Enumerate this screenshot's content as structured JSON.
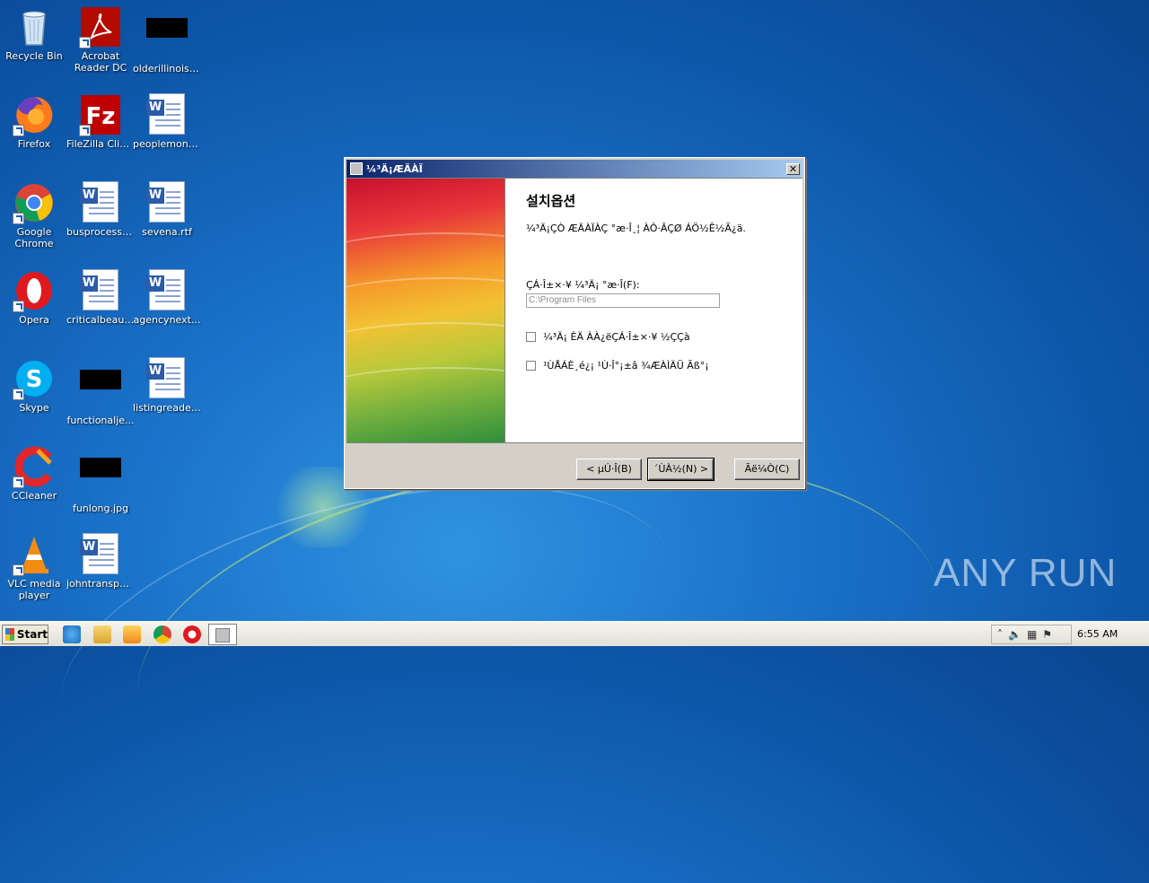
{
  "desktop": {
    "icons": [
      {
        "label": "Recycle Bin",
        "icon": "recycle-bin-icon"
      },
      {
        "label": "Acrobat Reader DC",
        "icon": "acrobat-icon"
      },
      {
        "label": "olderillinois.jpg",
        "icon": "image-file-icon"
      },
      {
        "label": "Firefox",
        "icon": "firefox-icon"
      },
      {
        "label": "FileZilla Client",
        "icon": "filezilla-icon"
      },
      {
        "label": "peoplemont...",
        "icon": "word-doc-icon"
      },
      {
        "label": "Google Chrome",
        "icon": "chrome-icon"
      },
      {
        "label": "busprocess.rtf",
        "icon": "word-doc-icon"
      },
      {
        "label": "sevena.rtf",
        "icon": "word-doc-icon"
      },
      {
        "label": "Opera",
        "icon": "opera-icon"
      },
      {
        "label": "criticalbeaut...",
        "icon": "word-doc-icon"
      },
      {
        "label": "agencynext...",
        "icon": "word-doc-icon"
      },
      {
        "label": "Skype",
        "icon": "skype-icon"
      },
      {
        "label": "functionalje...",
        "icon": "image-file-icon"
      },
      {
        "label": "listingreader...",
        "icon": "word-doc-icon"
      },
      {
        "label": "CCleaner",
        "icon": "ccleaner-icon"
      },
      {
        "label": "funlong.jpg",
        "icon": "image-file-icon"
      },
      {
        "label": "VLC media player",
        "icon": "vlc-icon"
      },
      {
        "label": "johntranspo...",
        "icon": "word-doc-icon"
      }
    ]
  },
  "dialog": {
    "title": "¼³Ä¡ÆÄÀÏ",
    "heading": "설치옵션",
    "description": "¼³Ä¡ÇÒ ÆÄÀÏÀÇ °æ·Î¸¦ ÀÔ·ÂÇØ ÁÖ½Ê½Ã¿ä.",
    "path_label": "ÇÁ·Î±×·¥ ¼³Ä¡ °æ·Î(F):",
    "path_value": "C:\\Program Files",
    "checkbox1": "¼³Ä¡ ÈÄ ÀÀ¿ëÇÁ·Î±×·¥ ½ÇÇà",
    "checkbox2": "¹ÙÅÁÈ­¸é¿¡ ¹Ù·Î°¡±â ¾ÆÀÌÄÜ Ãß°¡",
    "back_button": "< µÚ·Î(B)",
    "next_button": "´ÙÀ½(N) >",
    "cancel_button": "Ãë¼Ò(C)"
  },
  "taskbar": {
    "start_label": "Start",
    "clock": "6:55 AM"
  },
  "watermark": "ANY RUN"
}
